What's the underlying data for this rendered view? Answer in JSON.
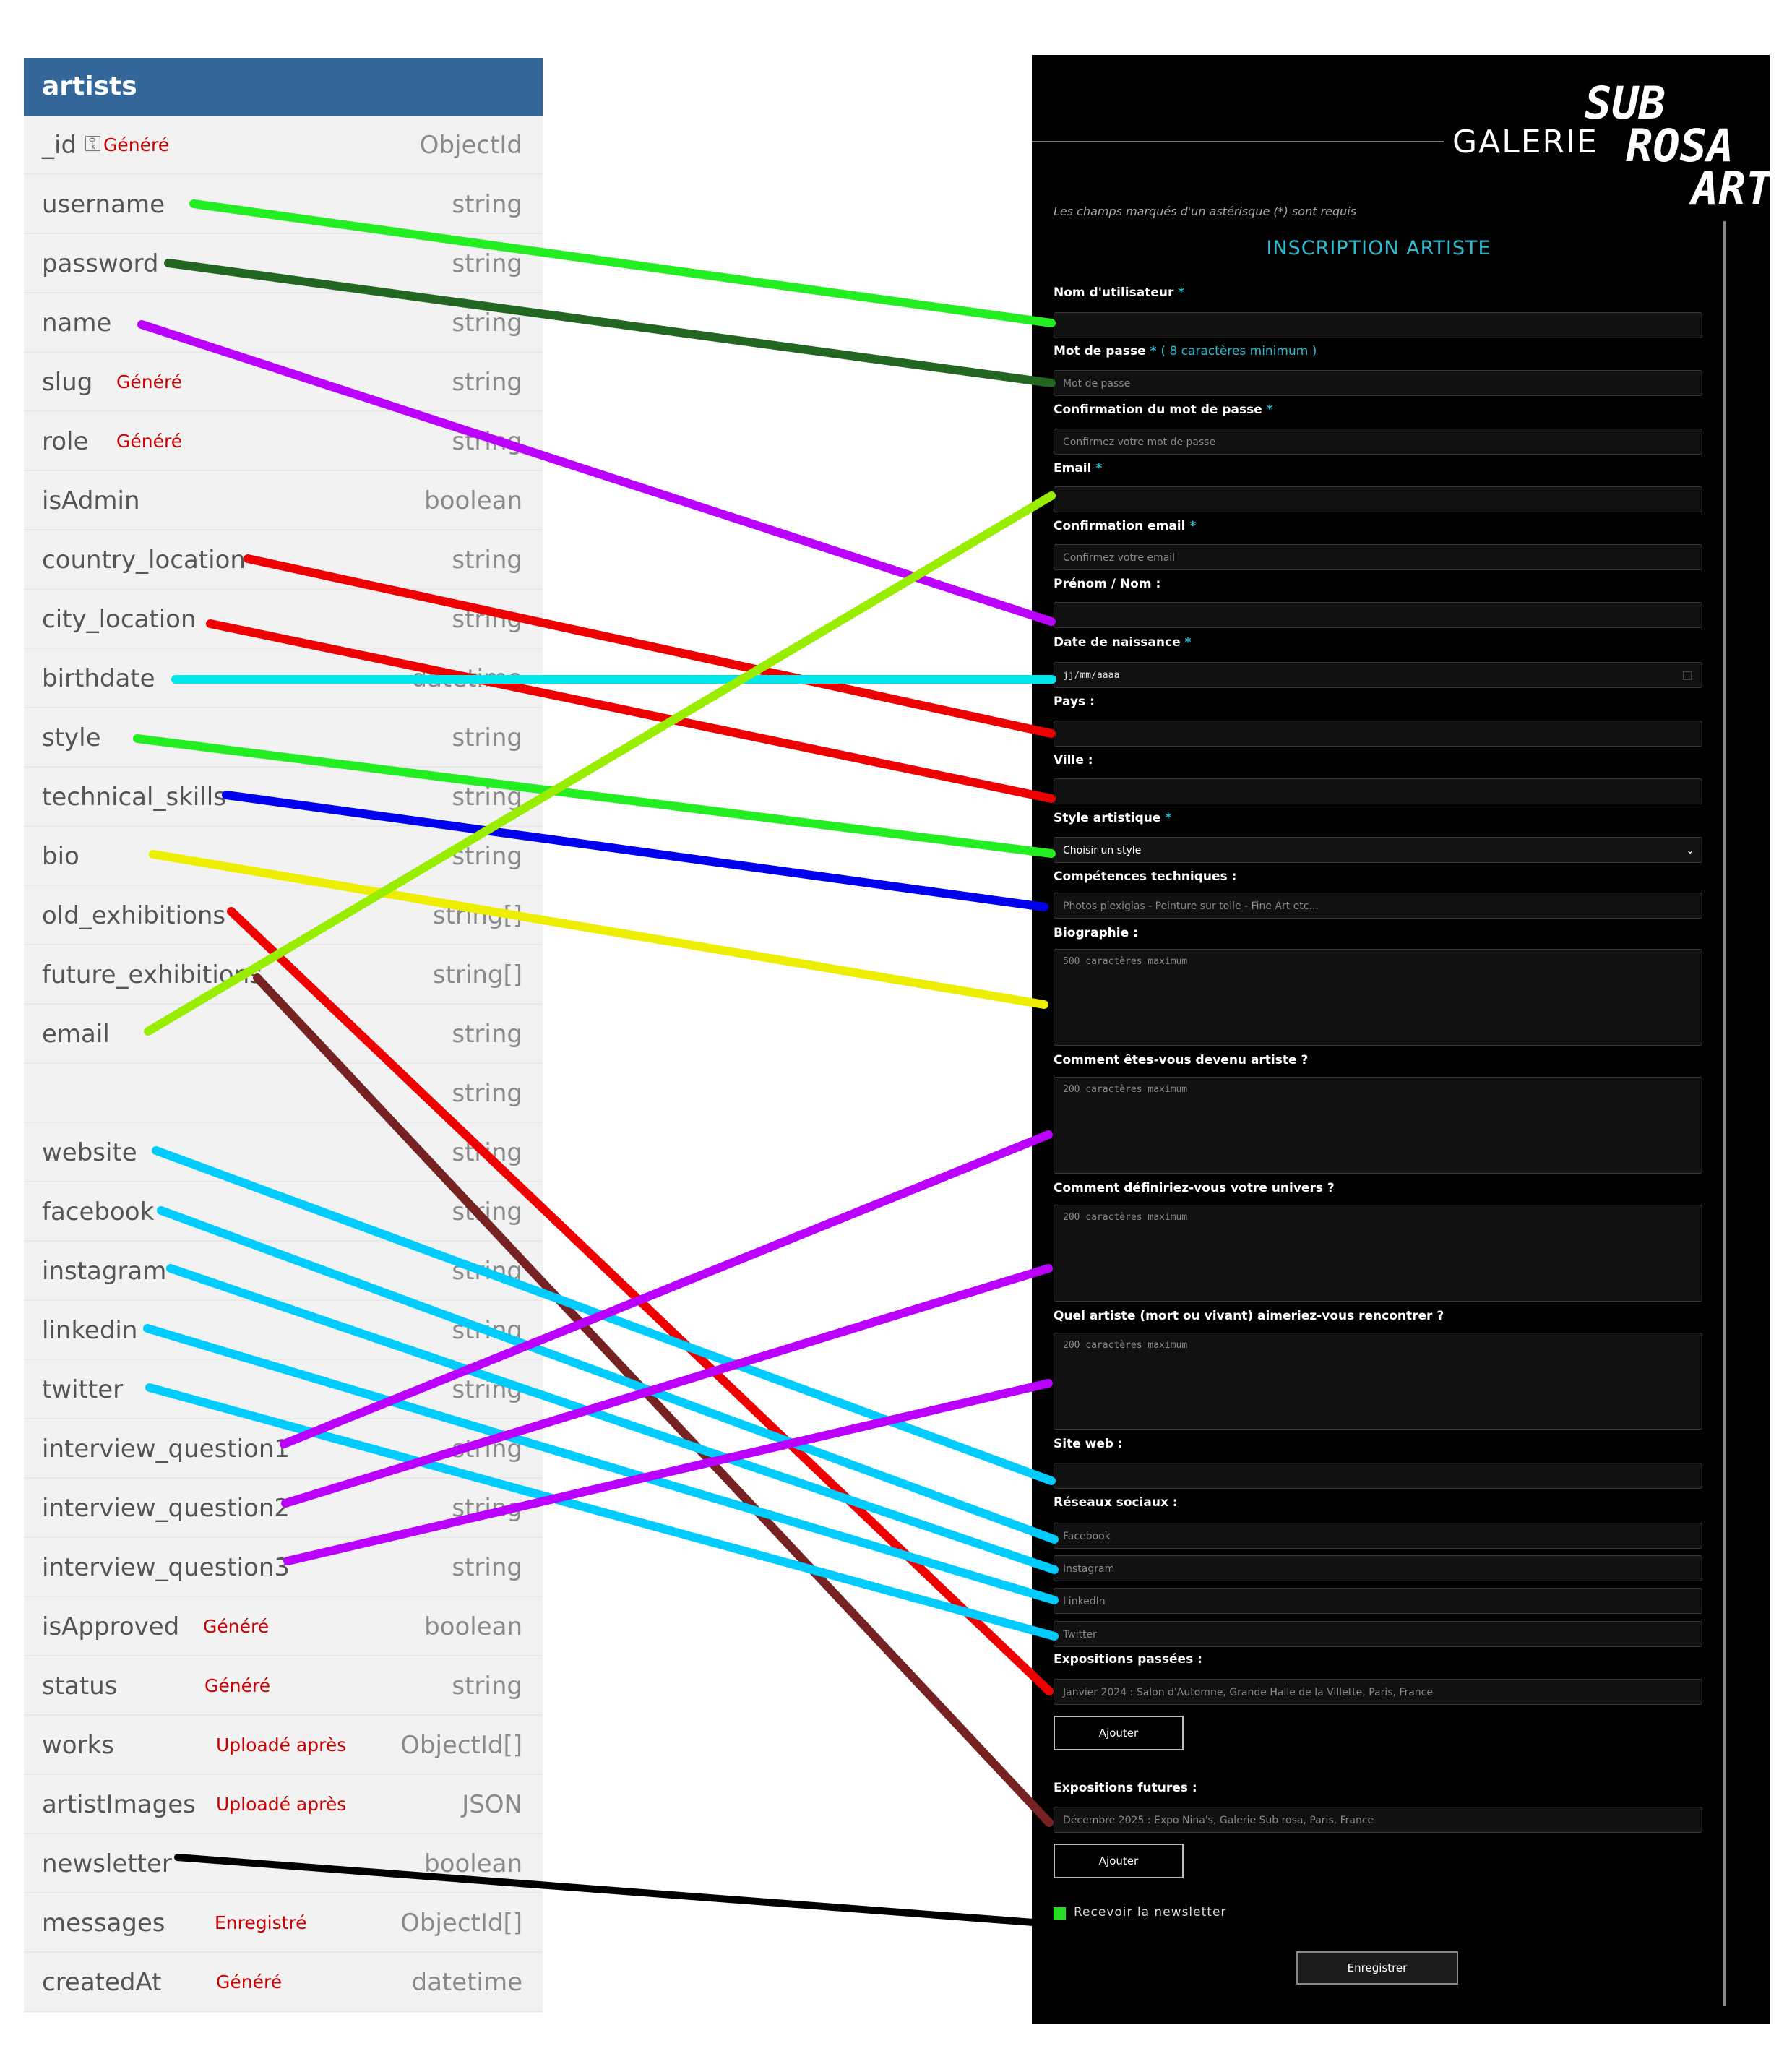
{
  "schema": {
    "title": "artists",
    "fields": [
      {
        "name": "_id",
        "type": "ObjectId",
        "note": "Généré",
        "key": true
      },
      {
        "name": "username",
        "type": "string"
      },
      {
        "name": "password",
        "type": "string"
      },
      {
        "name": "name",
        "type": "string"
      },
      {
        "name": "slug",
        "type": "string",
        "note": "Généré"
      },
      {
        "name": "role",
        "type": "string",
        "note": "Généré"
      },
      {
        "name": "isAdmin",
        "type": "boolean"
      },
      {
        "name": "country_location",
        "type": "string"
      },
      {
        "name": "city_location",
        "type": "string"
      },
      {
        "name": "birthdate",
        "type": "datetime"
      },
      {
        "name": "style",
        "type": "string"
      },
      {
        "name": "technical_skills",
        "type": "string"
      },
      {
        "name": "bio",
        "type": "string"
      },
      {
        "name": "old_exhibitions",
        "type": "string[]"
      },
      {
        "name": "future_exhibitions",
        "type": "string[]"
      },
      {
        "name": "email",
        "type": "string"
      },
      {
        "name": "",
        "type": "string"
      },
      {
        "name": "website",
        "type": "string"
      },
      {
        "name": "facebook",
        "type": "string"
      },
      {
        "name": "instagram",
        "type": "string"
      },
      {
        "name": "linkedin",
        "type": "string"
      },
      {
        "name": "twitter",
        "type": "string"
      },
      {
        "name": "interview_question1",
        "type": "string"
      },
      {
        "name": "interview_question2",
        "type": "string"
      },
      {
        "name": "interview_question3",
        "type": "string"
      },
      {
        "name": "isApproved",
        "type": "boolean",
        "note": "Généré"
      },
      {
        "name": "status",
        "type": "string",
        "note": "Généré"
      },
      {
        "name": "works",
        "type": "ObjectId[]",
        "note": "Uploadé après"
      },
      {
        "name": "artistImages",
        "type": "JSON",
        "note": "Uploadé après"
      },
      {
        "name": "newsletter",
        "type": "boolean"
      },
      {
        "name": "messages",
        "type": "ObjectId[]",
        "note": "Enregistré"
      },
      {
        "name": "createdAt",
        "type": "datetime",
        "note": "Généré"
      }
    ]
  },
  "form": {
    "logo": {
      "gallery": "GALERIE",
      "sub": "SUB",
      "rosa": "ROSA",
      "art": "ART"
    },
    "required_note": "Les champs marqués d'un astérisque (*) sont requis",
    "title": "INSCRIPTION ARTISTE",
    "fields": {
      "username": {
        "label": "Nom d'utilisateur",
        "req": "*",
        "placeholder": ""
      },
      "password": {
        "label": "Mot de passe",
        "req": "*",
        "hint": "( 8 caractères minimum )",
        "placeholder": "Mot de passe"
      },
      "password_confirm": {
        "label": "Confirmation du mot de passe",
        "req": "*",
        "placeholder": "Confirmez votre mot de passe"
      },
      "email": {
        "label": "Email",
        "req": "*",
        "placeholder": ""
      },
      "email_confirm": {
        "label": "Confirmation email",
        "req": "*",
        "placeholder": "Confirmez votre email"
      },
      "name": {
        "label": "Prénom / Nom :",
        "placeholder": ""
      },
      "birthdate": {
        "label": "Date de naissance",
        "req": "*",
        "value": "jj/mm/aaaa"
      },
      "country": {
        "label": "Pays :",
        "placeholder": ""
      },
      "city": {
        "label": "Ville :",
        "placeholder": ""
      },
      "style": {
        "label": "Style artistique",
        "req": "*",
        "selected": "Choisir un style"
      },
      "skills": {
        "label": "Compétences techniques :",
        "placeholder": "Photos plexiglas - Peinture sur toile - Fine Art etc..."
      },
      "bio": {
        "label": "Biographie :",
        "placeholder": "500 caractères maximum"
      },
      "q1": {
        "label": "Comment êtes-vous devenu artiste ?",
        "placeholder": "200 caractères maximum"
      },
      "q2": {
        "label": "Comment définiriez-vous votre univers ?",
        "placeholder": "200 caractères maximum"
      },
      "q3": {
        "label": "Quel artiste (mort ou vivant) aimeriez-vous rencontrer ?",
        "placeholder": "200 caractères maximum"
      },
      "website": {
        "label": "Site web :",
        "placeholder": ""
      },
      "social": {
        "label": "Réseaux sociaux :",
        "facebook": "Facebook",
        "instagram": "Instagram",
        "linkedin": "LinkedIn",
        "twitter": "Twitter"
      },
      "old_exhibitions": {
        "label": "Expositions passées :",
        "placeholder": "Janvier 2024 :  Salon d'Automne,  Grande Halle de la Villette, Paris, France",
        "button": "Ajouter"
      },
      "future_exhibitions": {
        "label": "Expositions futures :",
        "placeholder": "Décembre 2025 : Expo Nina's,  Galerie Sub rosa, Paris, France",
        "button": "Ajouter"
      },
      "newsletter": {
        "label": "Recevoir la newsletter",
        "color": "#22dd22"
      }
    },
    "submit": "Enregistrer"
  },
  "connections": [
    {
      "field": "username",
      "target": "username",
      "color": "#22ee22"
    },
    {
      "field": "password",
      "target": "password",
      "color": "#226622"
    },
    {
      "field": "name",
      "target": "name",
      "color": "#bb00ff"
    },
    {
      "field": "country_location",
      "target": "country",
      "color": "#ee0000"
    },
    {
      "field": "city_location",
      "target": "city",
      "color": "#ee0000"
    },
    {
      "field": "birthdate",
      "target": "birthdate",
      "color": "#00e5ee"
    },
    {
      "field": "style",
      "target": "style",
      "color": "#22ee22"
    },
    {
      "field": "technical_skills",
      "target": "skills",
      "color": "#0000ee"
    },
    {
      "field": "bio",
      "target": "bio",
      "color": "#eeee00"
    },
    {
      "field": "old_exhibitions",
      "target": "old_exhibitions",
      "color": "#ee0000"
    },
    {
      "field": "future_exhibitions",
      "target": "future_exhibitions",
      "color": "#772222"
    },
    {
      "field": "email",
      "target": "email",
      "color": "#99ee00"
    },
    {
      "field": "website",
      "target": "website",
      "color": "#00ccff"
    },
    {
      "field": "facebook",
      "target": "facebook",
      "color": "#00ccff"
    },
    {
      "field": "instagram",
      "target": "instagram",
      "color": "#00ccff"
    },
    {
      "field": "linkedin",
      "target": "linkedin",
      "color": "#00ccff"
    },
    {
      "field": "twitter",
      "target": "twitter",
      "color": "#00ccff"
    },
    {
      "field": "interview_question1",
      "target": "q1",
      "color": "#bb00ff"
    },
    {
      "field": "interview_question2",
      "target": "q2",
      "color": "#bb00ff"
    },
    {
      "field": "interview_question3",
      "target": "q3",
      "color": "#bb00ff"
    },
    {
      "field": "newsletter",
      "target": "newsletter",
      "color": "#000000"
    }
  ]
}
